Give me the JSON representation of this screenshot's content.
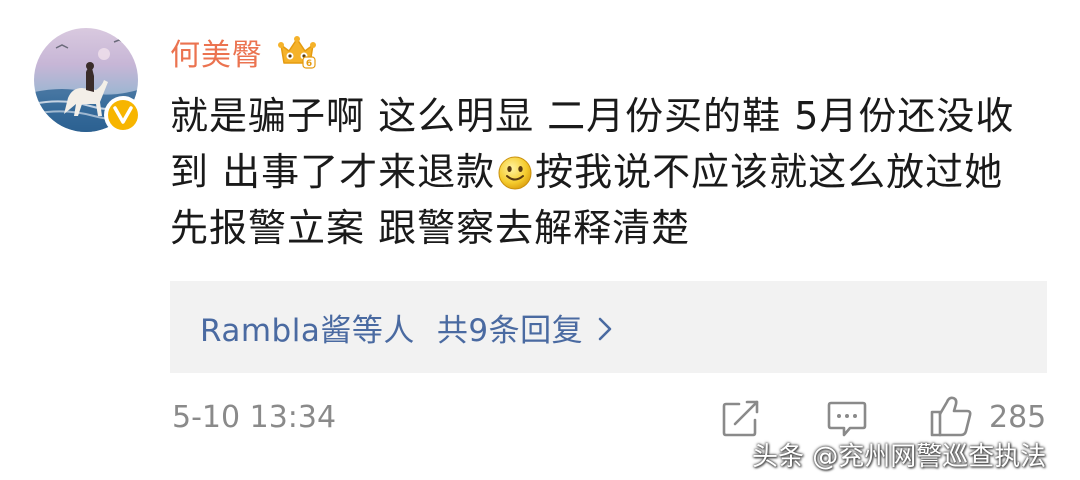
{
  "user": {
    "name": "何美臀",
    "avatar_icon": "avatar-horse-beach",
    "verified_icon": "verified-v-badge",
    "rank_icon": "crown-level-icon"
  },
  "comment": {
    "line1": "就是骗子啊 这么明显 二月份买的鞋 5月份还没收",
    "line2_before": "到 出事了才来退款",
    "line2_after": "按我说不应该就这么放过她",
    "line3": "先报警立案 跟警察去解释清楚",
    "emoji_icon": "smile-icon"
  },
  "replies": {
    "first_replier": "Rambla酱等人",
    "count_text": "共9条回复"
  },
  "footer": {
    "timestamp": "5-10 13:34",
    "like_count": "285"
  },
  "watermark": "头条 @兖州网警巡查执法",
  "colors": {
    "username": "#eb7350",
    "link": "#4a6aa1",
    "meta": "#8a8a8a",
    "reply_bg": "#f2f2f2",
    "badge": "#f7b500"
  }
}
